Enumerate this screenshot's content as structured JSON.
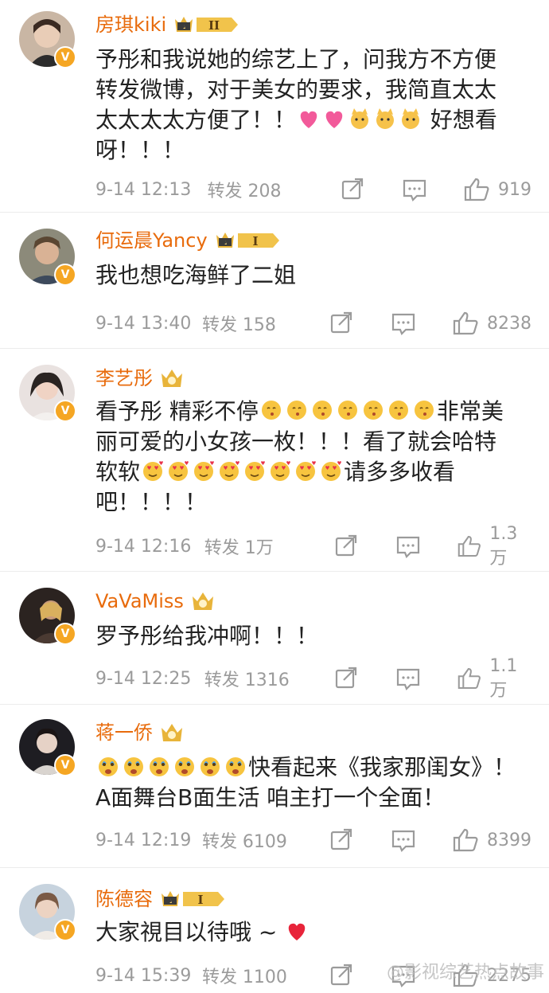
{
  "comments": [
    {
      "name": "房琪kiki",
      "level": "II",
      "text": "予彤和我说她的综艺上了，问我方不方便转发微博，对于美女的要求，我简直太太太太太太方便了！！",
      "tail": " 好想看呀！！！",
      "emojis": [
        "heart",
        "heart",
        "cat",
        "cat",
        "cat"
      ],
      "time": "9-14 12:13",
      "repost": "转发 208",
      "likes": "919"
    },
    {
      "name": "何运晨Yancy",
      "level": "I",
      "text": "我也想吃海鲜了二姐",
      "tail": "",
      "emojis": [],
      "time": "9-14 13:40",
      "repost": "转发 158",
      "likes": "8238"
    },
    {
      "name": "李艺彤",
      "level": "",
      "text": "看予彤 精彩不停",
      "mid": "非常美丽可爱的小女孩一枚！！！看了就会哈特软软",
      "tail": "请多多收看吧！！！！",
      "emojis": [
        "kiss",
        "kiss",
        "kiss",
        "kiss",
        "kiss",
        "kiss",
        "kiss"
      ],
      "emojis2": [
        "love",
        "love",
        "love",
        "love",
        "love",
        "love",
        "love",
        "love"
      ],
      "time": "9-14 12:16",
      "repost": "转发 1万",
      "likes": "1.3万"
    },
    {
      "name": "VaVaMiss",
      "level": "",
      "text": "罗予彤给我冲啊！！！",
      "tail": "",
      "emojis": [],
      "time": "9-14 12:25",
      "repost": "转发 1316",
      "likes": "1.1万"
    },
    {
      "name": "蒋一侨",
      "level": "",
      "text": "快看起来《我家那闺女》！A面舞台B面生活 咱主打一个全面！",
      "tail": "",
      "emojis": [
        "wow",
        "wow",
        "wow",
        "wow",
        "wow",
        "wow"
      ],
      "time": "9-14 12:19",
      "repost": "转发 6109",
      "likes": "8399"
    },
    {
      "name": "陈德容",
      "level": "I",
      "text": "大家視目以待哦 ~",
      "tail": "",
      "emojis": [
        "redheart"
      ],
      "time": "9-14 15:39",
      "repost": "转发 1100",
      "likes": "2275"
    }
  ],
  "watermark": "@影视综艺热点故事",
  "colors": {
    "name": "#e86b0c",
    "meta": "#9b9b9b",
    "verified": "#f5a623"
  },
  "icons": [
    "share-icon",
    "comment-icon",
    "like-icon",
    "verified-icon",
    "crown-icon"
  ]
}
